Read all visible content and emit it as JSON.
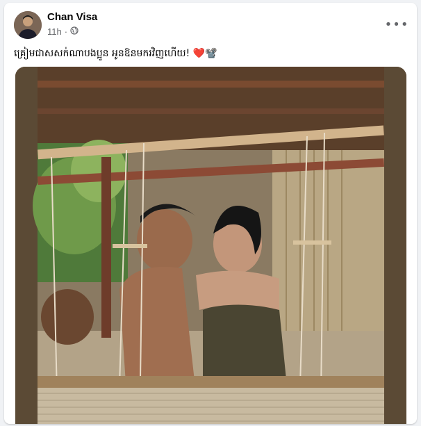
{
  "post": {
    "author": "Chan Visa",
    "time": "11h",
    "separator": "·",
    "audience_icon": "globe-icon",
    "more_icon": "more-options-icon",
    "caption": "គ្រៀមជាសសក់ណាបងប្អូន អូនឱនមករវិញហើយ!",
    "caption_emoji": "❤️📽️"
  },
  "photo": {
    "description_icon": "photo-image",
    "frame_color": "#5b4a35"
  }
}
